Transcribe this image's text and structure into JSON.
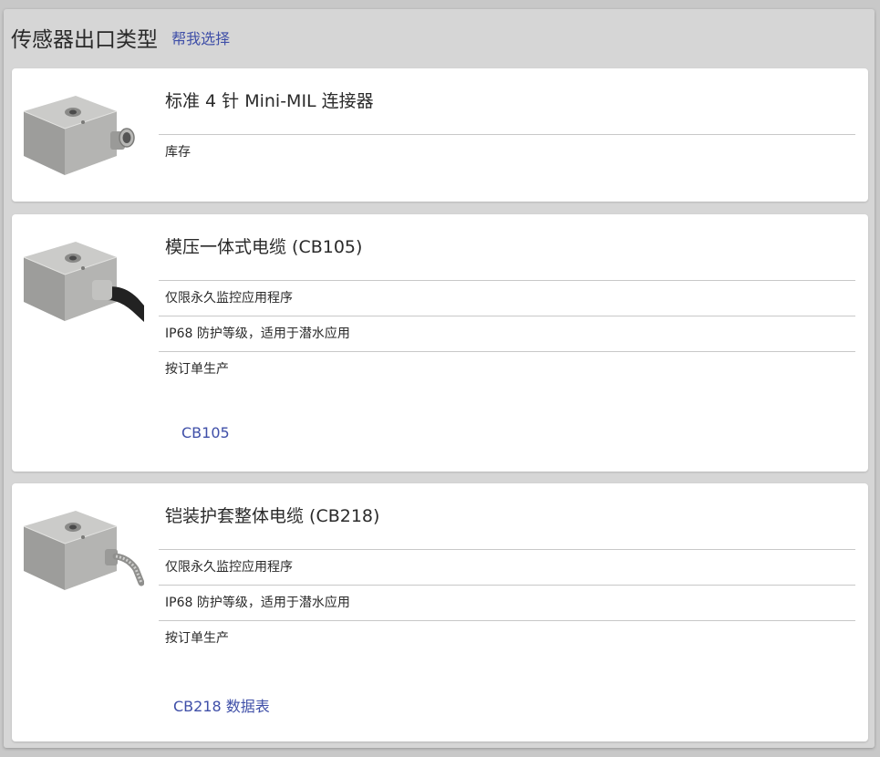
{
  "header": {
    "title": "传感器出口类型",
    "help_link": "帮我选择"
  },
  "options": [
    {
      "title": "标准 4 针 Mini-MIL 连接器",
      "image_icon": "sensor-connector-icon",
      "features": [
        "库存"
      ],
      "link": ""
    },
    {
      "title": "模压一体式电缆 (CB105)",
      "image_icon": "sensor-molded-cable-icon",
      "features": [
        "仅限永久监控应用程序",
        "IP68 防护等级，适用于潜水应用",
        "按订单生产"
      ],
      "link": "CB105"
    },
    {
      "title": "铠装护套整体电缆 (CB218)",
      "image_icon": "sensor-armored-cable-icon",
      "features": [
        "仅限永久监控应用程序",
        "IP68 防护等级，适用于潜水应用",
        "按订单生产"
      ],
      "link": "CB218 数据表"
    }
  ],
  "colors": {
    "link": "#3f4fa8",
    "panel": "#d6d6d6",
    "card": "#ffffff",
    "sensor_body": "#a9a9a7"
  }
}
